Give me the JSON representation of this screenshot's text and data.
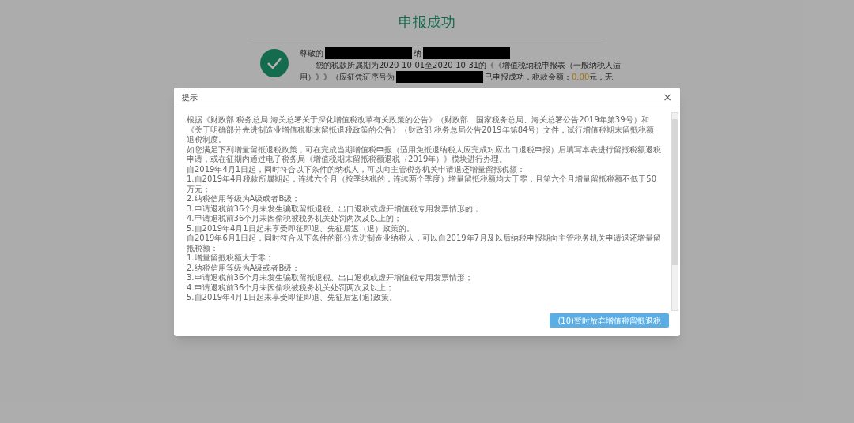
{
  "page": {
    "title": "申报成功",
    "lines": [
      {
        "indent": false,
        "segments": [
          {
            "kind": "text",
            "text": "尊敬的"
          },
          {
            "kind": "redaction"
          },
          {
            "kind": "text",
            "text": "纳"
          },
          {
            "kind": "redaction"
          }
        ]
      },
      {
        "indent": true,
        "segments": [
          {
            "kind": "text",
            "text": "您的税款所属期为2020-10-01至2020-10-31的《《增值税纳税申报表（一般纳税人适"
          }
        ]
      },
      {
        "indent": false,
        "segments": [
          {
            "kind": "text",
            "text": "用）》》（应征凭证序号为"
          },
          {
            "kind": "redaction"
          },
          {
            "kind": "text",
            "text": "已申报成功，税款金额："
          },
          {
            "kind": "amount",
            "text": "0.00"
          },
          {
            "kind": "text",
            "text": "元，无"
          }
        ]
      }
    ]
  },
  "dialog": {
    "title": "提示",
    "close": "×",
    "paragraphs": [
      "根据《财政部 税务总局 海关总署关于深化增值税改革有关政策的公告》（财政部、国家税务总局、海关总署公告2019年第39号）和《关于明确部分先进制造业增值税期末留抵退税政策的公告》（财政部 税务总局公告2019年第84号）文件，试行增值税期末留抵税额退税制度。",
      "如您满足下列增量留抵退税政策，可在完成当期增值税申报（适用免抵退纳税人应完成对应出口退税申报）后填写本表进行留抵税额退税申请，或在征期内通过电子税务局《增值税期末留抵税额退税（2019年）》模块进行办理。",
      "自2019年4月1日起，同时符合以下条件的纳税人，可以向主管税务机关申请退还增量留抵税额：",
      "1.自2019年4月税款所属期起，连续六个月（按季纳税的，连续两个季度）增量留抵税额均大于零，且第六个月增量留抵税额不低于50万元；",
      "2.纳税信用等级为A级或者B级；",
      "3.申请退税前36个月未发生骗取留抵退税、出口退税或虚开增值税专用发票情形的；",
      "4.申请退税前36个月未因偷税被税务机关处罚两次及以上的；",
      "5.自2019年4月1日起未享受即征即退、先征后返（退）政策的。",
      "自2019年6月1日起，同时符合以下条件的部分先进制造业纳税人，可以自2019年7月及以后纳税申报期向主管税务机关申请退还增量留抵税额：",
      "1.增量留抵税额大于零；",
      "2.纳税信用等级为A级或者B级；",
      "3.申请退税前36个月未发生骗取留抵退税、出口退税或虚开增值税专用发票情形；",
      "4.申请退税前36个月未因偷税被税务机关处罚两次及以上；",
      "5.自2019年4月1日起未享受即征即退、先征后返(退)政策。"
    ],
    "button": "(10)暂时放弃增值税留抵退税"
  }
}
